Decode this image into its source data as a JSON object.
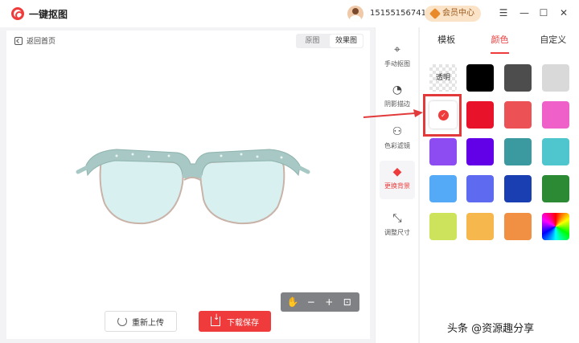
{
  "app": {
    "title": "一键抠图",
    "phone": "15155156741",
    "vip_label": "会员中心"
  },
  "window": {
    "min": "—",
    "max": "☐",
    "close": "✕",
    "menu": "☰"
  },
  "canvas": {
    "back_label": "返回首页",
    "view_original": "原图",
    "view_effect": "效果图"
  },
  "zoom": {
    "hand": "✋",
    "zoom_out": "−",
    "zoom_in": "+",
    "fit": "⊡"
  },
  "actions": {
    "reupload": "重新上传",
    "save": "下载保存"
  },
  "tools": [
    {
      "label": "手动抠图",
      "icon": "cursor-icon",
      "glyph": "⌖"
    },
    {
      "label": "阴影描边",
      "icon": "shadow-icon",
      "glyph": "◔"
    },
    {
      "label": "色彩滤镜",
      "icon": "color-filter-icon",
      "glyph": "⚇"
    },
    {
      "label": "更换背景",
      "icon": "paint-bucket-icon",
      "glyph": "◆"
    },
    {
      "label": "调整尺寸",
      "icon": "resize-icon",
      "glyph": "⤡"
    }
  ],
  "tabs": [
    "模板",
    "颜色",
    "自定义"
  ],
  "active_tab": "颜色",
  "swatches": {
    "transparent_label": "透明",
    "selected_check": "✓",
    "colors": [
      "#000000",
      "#4d4d4d",
      "#d9d9d9",
      "#e8132a",
      "#ec5156",
      "#ef61c9",
      "#8c4cf2",
      "#6200e8",
      "#3a9a9f",
      "#4fc6ce",
      "#55aaf7",
      "#5e6bf0",
      "#1a3fb2",
      "#2b8a33",
      "#cde35b",
      "#f6b74c",
      "#f19043"
    ]
  },
  "watermark": "头条 @资源趣分享",
  "arrow_color": "#e23a3a"
}
